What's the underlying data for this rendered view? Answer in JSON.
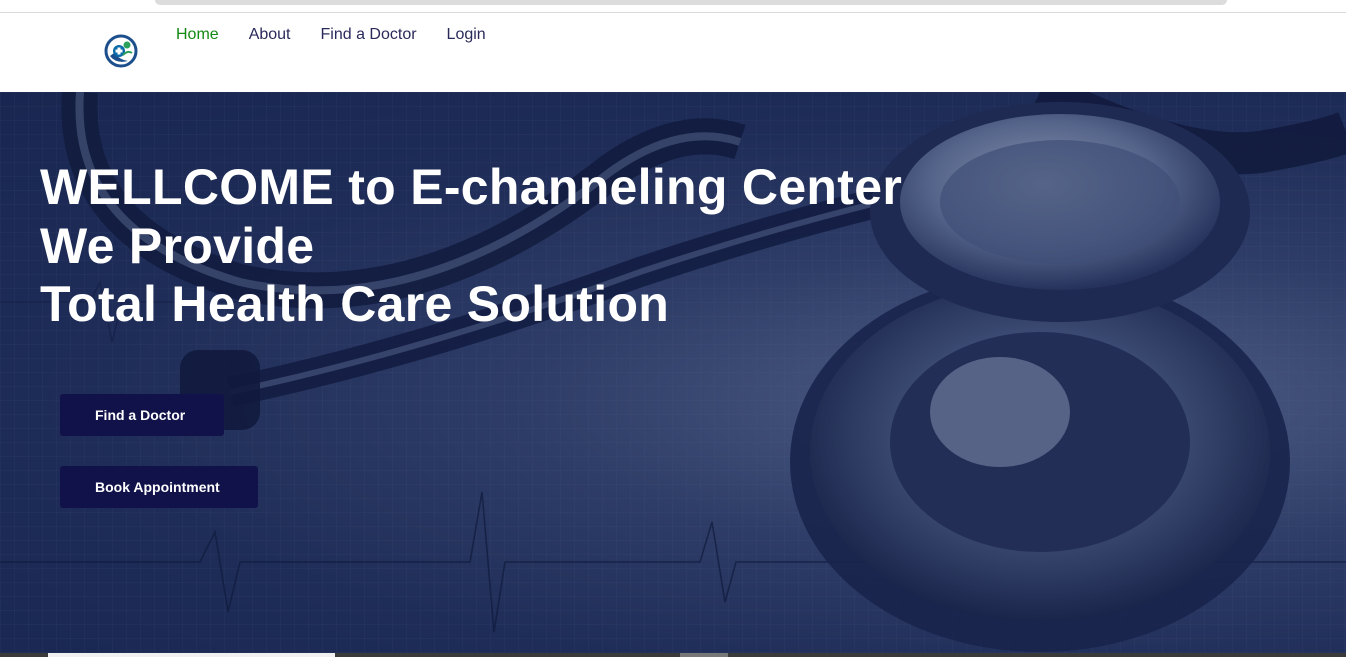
{
  "nav": {
    "items": [
      {
        "label": "Home",
        "active": true
      },
      {
        "label": "About",
        "active": false
      },
      {
        "label": "Find a Doctor",
        "active": false
      },
      {
        "label": "Login",
        "active": false
      }
    ]
  },
  "hero": {
    "title_lines": [
      "WELLCOME to E-channeling Center",
      "We Provide",
      "Total Health Care Solution"
    ],
    "find_doctor_label": "Find a Doctor",
    "book_appointment_label": "Book Appointment"
  },
  "colors": {
    "nav_active": "#138a13",
    "nav_default": "#2a2a5a",
    "button_bg": "#11124a",
    "hero_overlay": "#22305a"
  },
  "icons": {
    "logo": "medical-cross-logo-icon"
  }
}
